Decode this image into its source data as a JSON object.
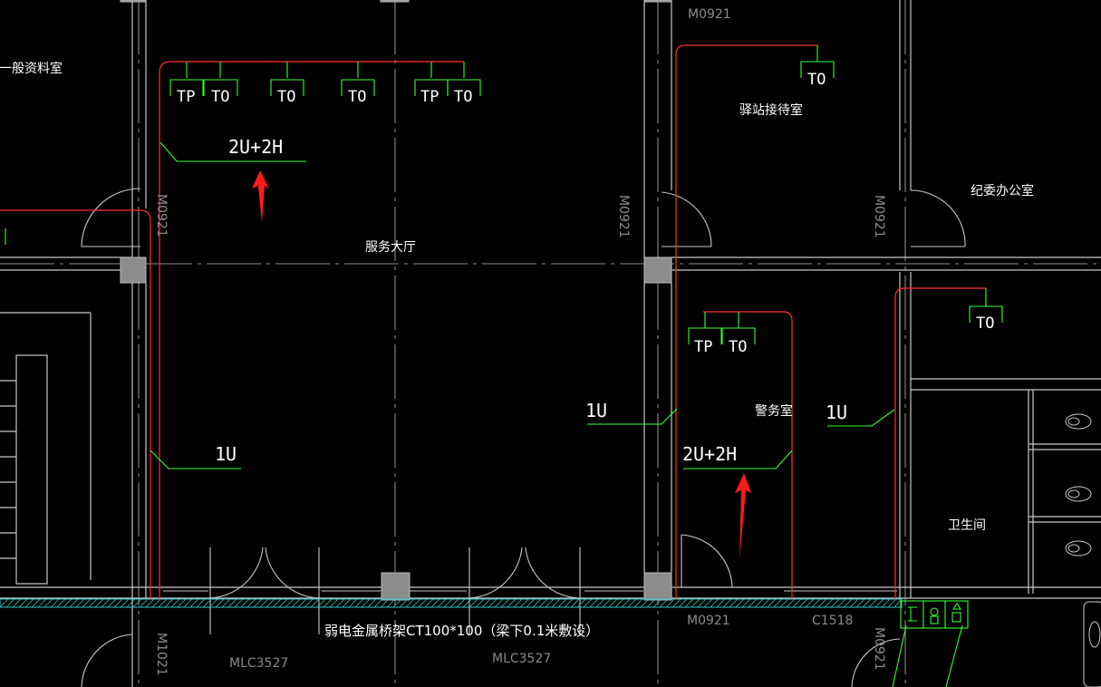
{
  "colors": {
    "background": "#000000",
    "wall": "#c8c8c8",
    "cable": "#ff3030",
    "outlet": "#33ff33",
    "cable_tray": "#30c8c8",
    "arrow": "#ff1a1a",
    "text": "#ffffff",
    "door_label": "#8a8a8a"
  },
  "rooms": {
    "general_archive": "一般资料室",
    "service_hall": "服务大厅",
    "station_reception": "驿站接待室",
    "discipline_office": "纪委办公室",
    "police_room": "警务室",
    "restroom": "卫生间"
  },
  "door_labels": {
    "top_m0921": "M0921",
    "m0921_left_vertical": "M0921",
    "m0921_mid_vertical": "M0921",
    "m0921_right_vertical": "M0921",
    "m1021_bottom_vertical": "M1021",
    "m0921_bottom": "M0921",
    "c1518": "C1518",
    "mlc_left": "MLC3527",
    "mlc_mid": "MLC3527",
    "m0921_bottom_right_vertical": "M0921"
  },
  "outlets": {
    "tp": "TP",
    "to": "TO"
  },
  "cable_labels": {
    "hall_top": "2U+2H",
    "hall_left": "1U",
    "police_left": "1U",
    "police_main": "2U+2H",
    "restroom_left": "1U"
  },
  "cable_tray_label": "弱电金属桥架CT100*100（梁下0.1米敷设）"
}
